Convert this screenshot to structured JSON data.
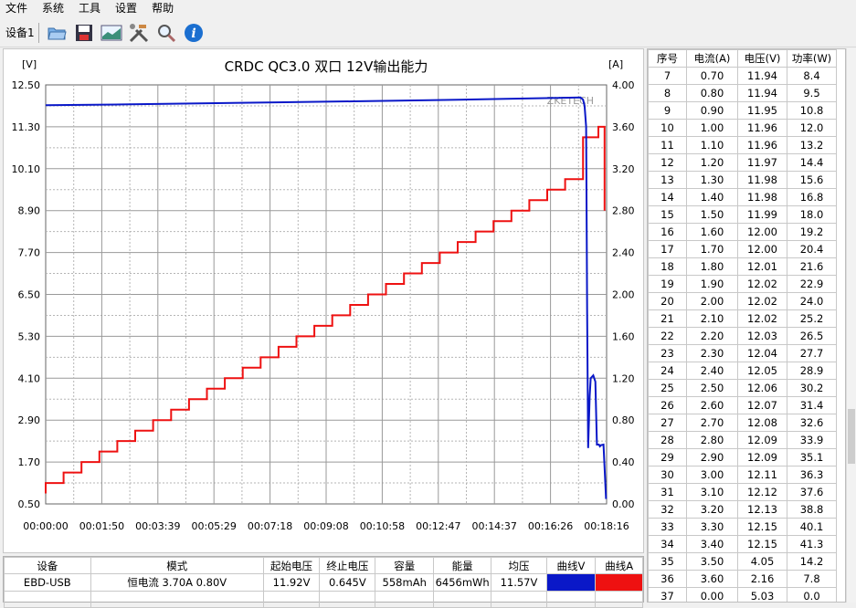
{
  "menu": [
    "文件",
    "系统",
    "工具",
    "设置",
    "帮助"
  ],
  "toolbar": {
    "device_tab": "设备1",
    "buttons": [
      "folder-icon",
      "save-icon",
      "chart-icon",
      "tools-icon",
      "search-icon",
      "info-icon"
    ]
  },
  "colors": {
    "voltage": "#0a18c8",
    "current": "#ee1111",
    "grid": "#999999"
  },
  "chart_data": {
    "type": "line",
    "title": "CRDC QC3.0 双口 12V输出能力",
    "left_unit": "[V]",
    "right_unit": "[A]",
    "watermark_text": "ZKETECH",
    "y_left_ticks": [
      "12.50",
      "11.30",
      "10.10",
      "8.90",
      "7.70",
      "6.50",
      "5.30",
      "4.10",
      "2.90",
      "1.70",
      "0.50"
    ],
    "y_right_ticks": [
      "4.00",
      "3.60",
      "3.20",
      "2.80",
      "2.40",
      "2.00",
      "1.60",
      "1.20",
      "0.80",
      "0.40",
      "0.00"
    ],
    "x_ticks": [
      "00:00:00",
      "00:01:50",
      "00:03:39",
      "00:05:29",
      "00:07:18",
      "00:09:08",
      "00:10:58",
      "00:12:47",
      "00:14:37",
      "00:16:26",
      "00:18:16"
    ],
    "ylim_left": [
      0.5,
      12.5
    ],
    "ylim_right": [
      0,
      4
    ],
    "xlim_seconds": [
      0,
      1096
    ],
    "series": [
      {
        "axis": "left",
        "x": [
          0,
          150,
          300,
          450,
          600,
          750,
          900,
          1000,
          1045,
          1050,
          1053,
          1056,
          1058,
          1060,
          1063,
          1065,
          1070,
          1074,
          1077,
          1081,
          1083,
          1085,
          1090,
          1095
        ],
        "y": [
          11.92,
          11.94,
          11.97,
          12.0,
          12.03,
          12.06,
          12.1,
          12.13,
          12.14,
          12.08,
          11.9,
          11.3,
          6.0,
          2.1,
          3.6,
          4.1,
          4.18,
          4.0,
          2.2,
          2.2,
          2.15,
          2.18,
          2.2,
          0.64
        ]
      },
      {
        "axis": "right",
        "step_x": [
          0,
          35,
          70,
          105,
          140,
          175,
          210,
          245,
          280,
          315,
          350,
          385,
          420,
          455,
          490,
          525,
          560,
          595,
          630,
          665,
          700,
          735,
          770,
          805,
          840,
          875,
          910,
          945,
          980,
          1015,
          1050,
          1080
        ],
        "step_y": [
          0.1,
          0.2,
          0.3,
          0.4,
          0.5,
          0.6,
          0.7,
          0.8,
          0.9,
          1.0,
          1.1,
          1.2,
          1.3,
          1.4,
          1.5,
          1.6,
          1.7,
          1.8,
          1.9,
          2.0,
          2.1,
          2.2,
          2.3,
          2.4,
          2.5,
          2.6,
          2.7,
          2.8,
          2.9,
          3.0,
          3.1,
          3.5,
          3.6
        ],
        "tail": [
          [
            1092,
            3.6
          ],
          [
            1092,
            2.8
          ]
        ]
      }
    ]
  },
  "table": {
    "headers": [
      "序号",
      "电流(A)",
      "电压(V)",
      "功率(W)"
    ],
    "rows": [
      [
        "7",
        "0.70",
        "11.94",
        "8.4"
      ],
      [
        "8",
        "0.80",
        "11.94",
        "9.5"
      ],
      [
        "9",
        "0.90",
        "11.95",
        "10.8"
      ],
      [
        "10",
        "1.00",
        "11.96",
        "12.0"
      ],
      [
        "11",
        "1.10",
        "11.96",
        "13.2"
      ],
      [
        "12",
        "1.20",
        "11.97",
        "14.4"
      ],
      [
        "13",
        "1.30",
        "11.98",
        "15.6"
      ],
      [
        "14",
        "1.40",
        "11.98",
        "16.8"
      ],
      [
        "15",
        "1.50",
        "11.99",
        "18.0"
      ],
      [
        "16",
        "1.60",
        "12.00",
        "19.2"
      ],
      [
        "17",
        "1.70",
        "12.00",
        "20.4"
      ],
      [
        "18",
        "1.80",
        "12.01",
        "21.6"
      ],
      [
        "19",
        "1.90",
        "12.02",
        "22.9"
      ],
      [
        "20",
        "2.00",
        "12.02",
        "24.0"
      ],
      [
        "21",
        "2.10",
        "12.02",
        "25.2"
      ],
      [
        "22",
        "2.20",
        "12.03",
        "26.5"
      ],
      [
        "23",
        "2.30",
        "12.04",
        "27.7"
      ],
      [
        "24",
        "2.40",
        "12.05",
        "28.9"
      ],
      [
        "25",
        "2.50",
        "12.06",
        "30.2"
      ],
      [
        "26",
        "2.60",
        "12.07",
        "31.4"
      ],
      [
        "27",
        "2.70",
        "12.08",
        "32.6"
      ],
      [
        "28",
        "2.80",
        "12.09",
        "33.9"
      ],
      [
        "29",
        "2.90",
        "12.09",
        "35.1"
      ],
      [
        "30",
        "3.00",
        "12.11",
        "36.3"
      ],
      [
        "31",
        "3.10",
        "12.12",
        "37.6"
      ],
      [
        "32",
        "3.20",
        "12.13",
        "38.8"
      ],
      [
        "33",
        "3.30",
        "12.15",
        "40.1"
      ],
      [
        "34",
        "3.40",
        "12.15",
        "41.3"
      ],
      [
        "35",
        "3.50",
        "4.05",
        "14.2"
      ],
      [
        "36",
        "3.60",
        "2.16",
        "7.8"
      ],
      [
        "37",
        "0.00",
        "5.03",
        "0.0"
      ]
    ]
  },
  "summary": {
    "headers": [
      "设备",
      "模式",
      "起始电压",
      "终止电压",
      "容量",
      "能量",
      "均压",
      "曲线V",
      "曲线A"
    ],
    "row": [
      "EBD-USB",
      "恒电流  3.70A  0.80V",
      "11.92V",
      "0.645V",
      "558mAh",
      "6456mWh",
      "11.57V"
    ]
  }
}
